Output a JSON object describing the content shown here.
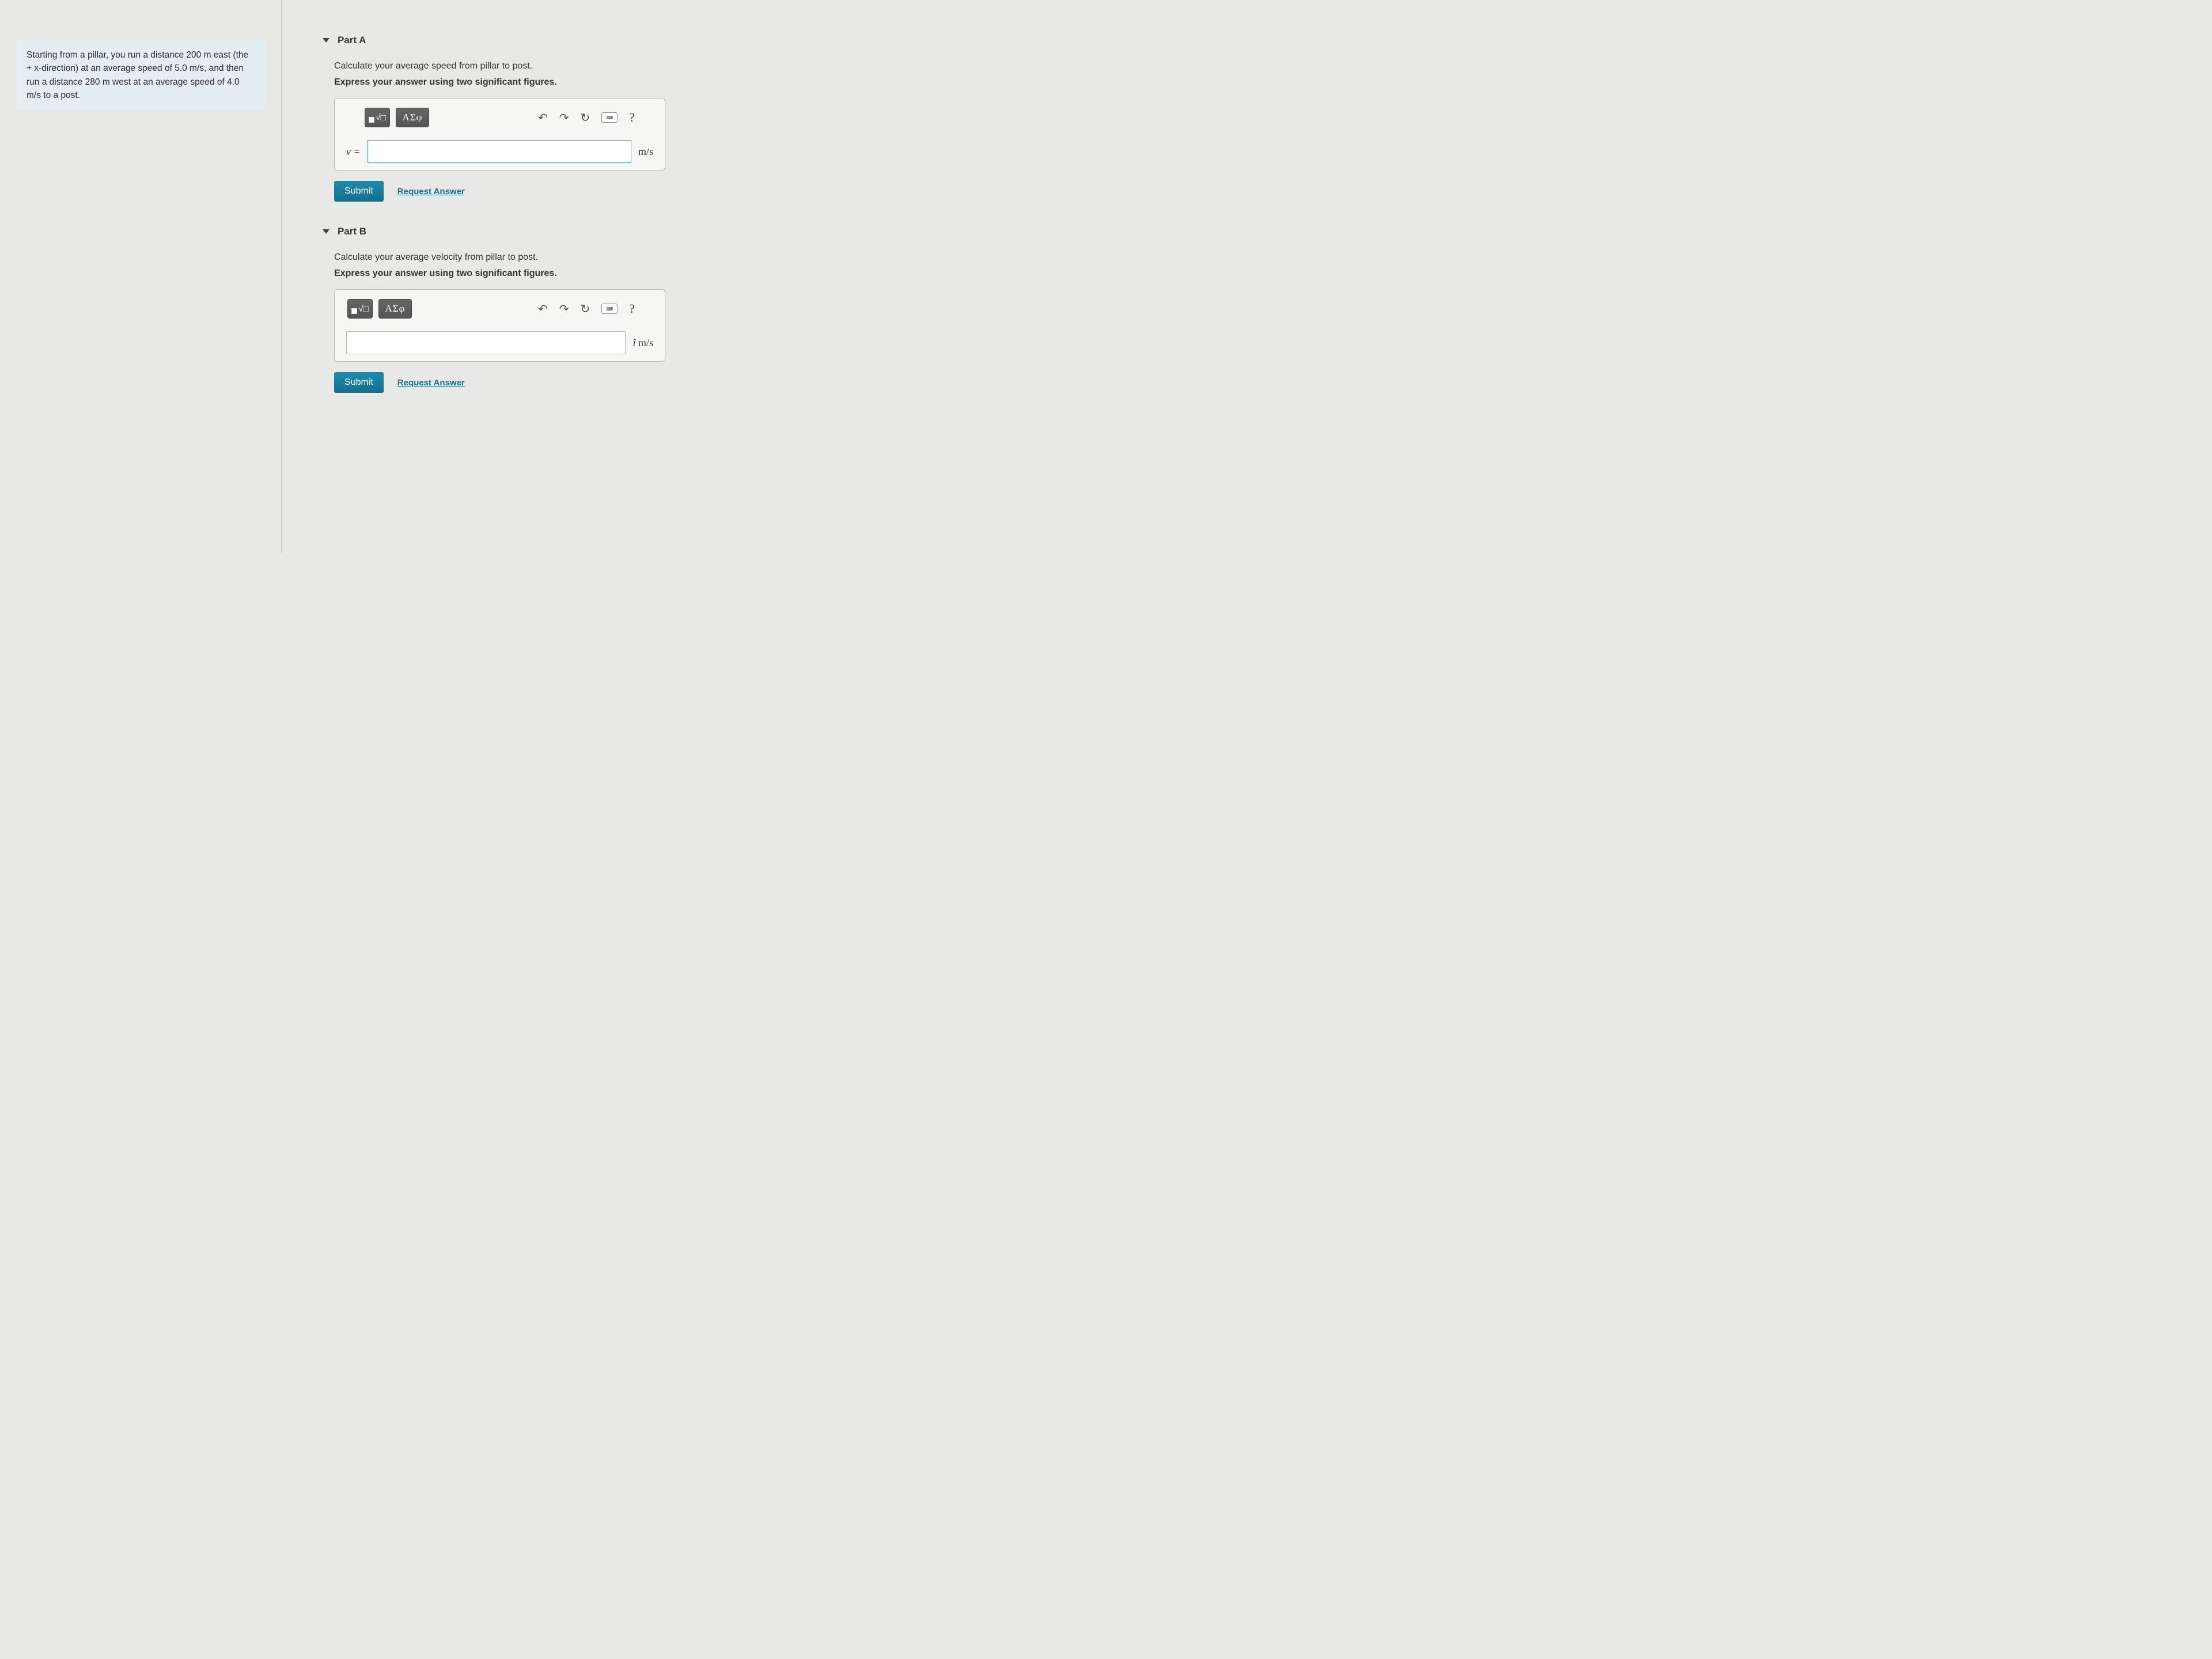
{
  "problem": {
    "text": "Starting from a pillar, you run a distance 200 m east (the + x-direction) at an average speed of 5.0 m/s, and then run a distance 280 m west at an average speed of 4.0 m/s to a post."
  },
  "partA": {
    "title": "Part A",
    "prompt": "Calculate your average speed from pillar to post.",
    "instruction": "Express your answer using two significant figures.",
    "greek_symbols": "ΑΣφ",
    "help_symbol": "?",
    "prefix": "v =",
    "value": "",
    "unit": "m/s",
    "submit_label": "Submit",
    "request_label": "Request Answer"
  },
  "partB": {
    "title": "Part B",
    "prompt": "Calculate your average velocity from pillar to post.",
    "instruction": "Express your answer using two significant figures.",
    "greek_symbols": "ΑΣφ",
    "help_symbol": "?",
    "value": "",
    "unit_prefix": "î",
    "unit": "m/s",
    "submit_label": "Submit",
    "request_label": "Request Answer"
  }
}
